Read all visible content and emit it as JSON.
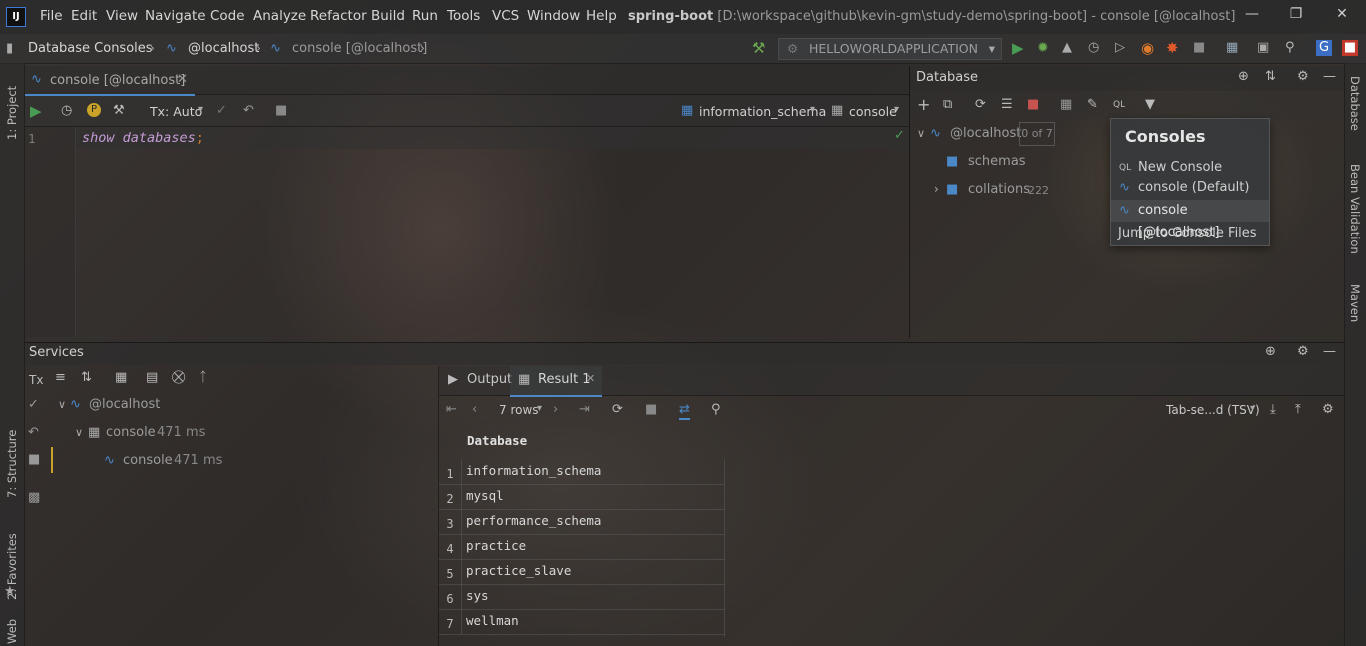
{
  "menu": {
    "items": [
      "File",
      "Edit",
      "View",
      "Navigate",
      "Code",
      "Analyze",
      "Refactor",
      "Build",
      "Run",
      "Tools",
      "VCS",
      "Window",
      "Help"
    ],
    "title_project": "spring-boot",
    "title_rest": "[D:\\workspace\\github\\kevin-gm\\study-demo\\spring-boot] - console [@localhost]"
  },
  "nav": {
    "crumbs": [
      "Database Consoles",
      "@localhost",
      "console [@localhost]"
    ],
    "run_config": "HELLOWORLDAPPLICATION"
  },
  "left_stripe": {
    "project": "1: Project",
    "structure": "7: Structure",
    "favorites": "2: Favorites",
    "web": "Web"
  },
  "right_stripe": {
    "database": "Database",
    "bean_validation": "Bean Validation",
    "maven": "Maven"
  },
  "editor": {
    "tab_label": "console [@localhost]",
    "tx_mode": "Tx: Auto",
    "schema_selector": "information_schema",
    "console_selector": "console",
    "line_number": "1",
    "code": "show databases",
    "code_terminator": ";"
  },
  "database_panel": {
    "title": "Database",
    "root_label": "@localhost",
    "root_badge": "0 of 7",
    "schemas_label": "schemas",
    "collations_label": "collations",
    "collations_count": "222"
  },
  "consoles_popup": {
    "title": "Consoles",
    "items": [
      "New Console",
      "console (Default)",
      "console [@localhost]",
      "Jump to Console Files"
    ]
  },
  "services": {
    "title": "Services",
    "tx_label": "Tx",
    "tree": {
      "root": "@localhost",
      "child": "console",
      "child_time": "471 ms",
      "leaf": "console",
      "leaf_time": "471 ms"
    }
  },
  "results": {
    "tabs": [
      "Output",
      "Result 1"
    ],
    "rows_label": "7 rows",
    "export_format": "Tab-se...d (TSV)",
    "column": "Database",
    "rows": [
      "information_schema",
      "mysql",
      "performance_schema",
      "practice",
      "practice_slave",
      "sys",
      "wellman"
    ]
  },
  "colors": {
    "accent_blue": "#4a88c7",
    "run_green": "#499c54",
    "keyword_purple": "#c49bd6",
    "stop_red": "#c75450"
  }
}
